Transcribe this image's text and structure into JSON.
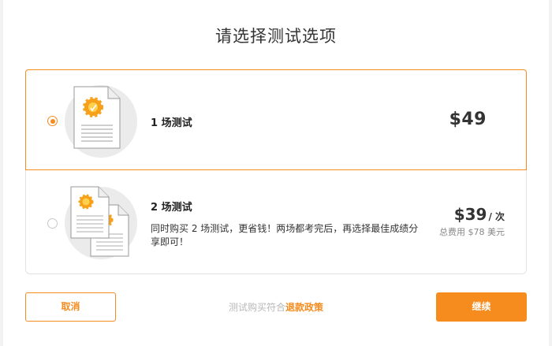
{
  "dialog": {
    "title": "请选择测试选项"
  },
  "options": [
    {
      "title": "1 场测试",
      "price": "$49",
      "selected": true,
      "icon": "document-icon"
    },
    {
      "title": "2 场测试",
      "description": "同时购买 2 场测试，更省钱！两场都考完后，再选择最佳成绩分享即可！",
      "price": "$39",
      "price_unit": "/ 次",
      "total": "总费用 $78 美元",
      "selected": false,
      "icon": "two-documents-icon"
    }
  ],
  "footer": {
    "cancel_label": "取消",
    "policy_prefix": "测试购买符合",
    "policy_link": "退款政策",
    "continue_label": "继续"
  },
  "colors": {
    "accent": "#f68b1e",
    "border": "#e3e3e3",
    "text": "#333333",
    "muted": "#b8b8b8"
  }
}
